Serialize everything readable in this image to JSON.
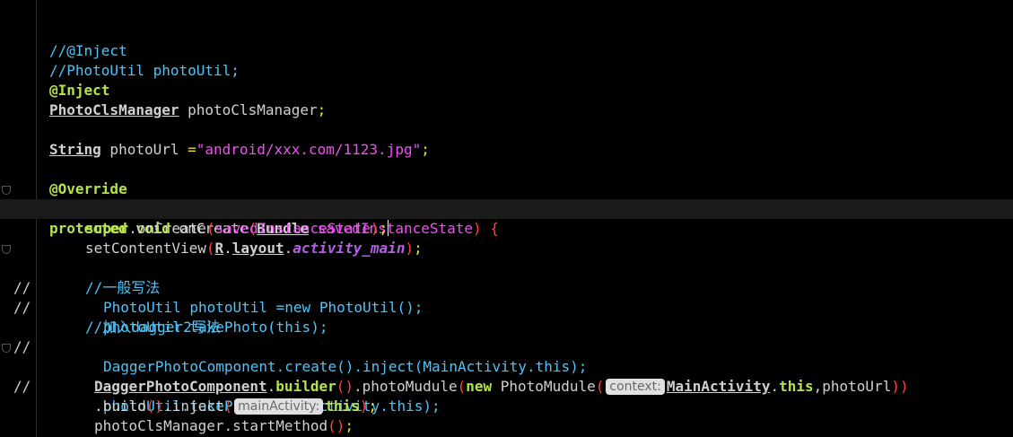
{
  "colors": {
    "background": "#000000",
    "comment": "#4fc3f7",
    "keyword": "#b4e34a",
    "string": "#f050f0",
    "paren": "#ff4040",
    "semicolon": "#f0e020",
    "field": "#b060e0",
    "hint_bg": "#e0e0e0"
  },
  "lines": {
    "l1": "//@Inject",
    "l2": "//PhotoUtil photoUtil;",
    "l3_ann": "@Inject",
    "l4_type": "PhotoClsManager",
    "l4_var": " photoClsManager",
    "l6_type": "String",
    "l6_var": " photoUrl ",
    "l6_eq": "=",
    "l6_str": "\"android/xxx.com/1123.jpg\"",
    "l8_ann": "@Override",
    "l9_kw1": "protected",
    "l9_kw2": " void",
    "l9_method": " onCreate",
    "l9_type": "Bundle",
    "l9_param": " savedInstanceState",
    "l10_super": "super",
    "l10_method": ".onCreate",
    "l10_param": "savedInstanceState",
    "l11_method": "setContentView",
    "l11_r": "R",
    "l11_layout": "layout",
    "l11_field": "activity_main",
    "l12": "//一般写法",
    "l13_marker": "//",
    "l13": "PhotoUtil photoUtil =new PhotoUtil();",
    "l14_marker": "//",
    "l14": "photoUtil.takePhoto(this);",
    "l15": "//加入dagger2写法",
    "l16_marker": "//",
    "l16": "DaggerPhotoComponent.create().inject(MainActivity.this);",
    "l17_marker": "//",
    "l17": "photoUtil.takePhoto(MainActivity.this);",
    "l18_cls": "DaggerPhotoComponent",
    "l18_builder": "builder",
    "l18_module": ".photoMudule",
    "l18_new": "new",
    "l18_ctor": " PhotoMudule",
    "l18_hint": "context:",
    "l18_main": "MainActivity",
    "l18_this": "this",
    "l18_url": "photoUrl",
    "l19_build": ".build",
    "l19_inject": ".inject",
    "l19_hint": "mainActivity:",
    "l19_this": "this",
    "l20_obj": "photoClsManager",
    "l20_method": ".startMethod",
    "l21": "}"
  }
}
